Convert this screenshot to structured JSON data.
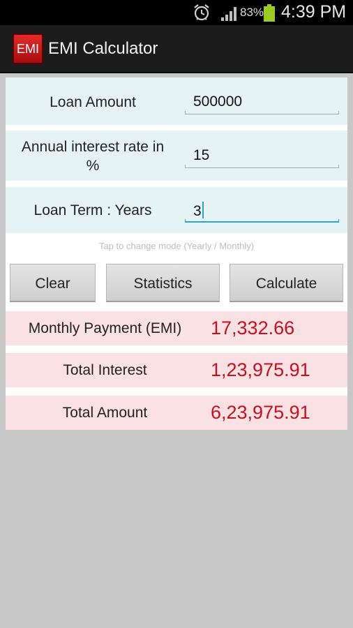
{
  "status_bar": {
    "battery_percent": "83%",
    "time": "4:39 PM",
    "icons": [
      "alarm-icon",
      "signal-icon",
      "battery-icon"
    ]
  },
  "app_bar": {
    "icon_text": "EMI",
    "title": "EMI Calculator"
  },
  "form": {
    "loan_amount": {
      "label": "Loan Amount",
      "value": "500000"
    },
    "interest_rate": {
      "label_line1": "Annual interest rate in",
      "label_line2": "%",
      "value": "15"
    },
    "loan_term": {
      "label": "Loan Term : Years",
      "value": "3"
    },
    "mode_hint": "Tap to change mode (Yearly / Monthly)"
  },
  "buttons": {
    "clear": "Clear",
    "statistics": "Statistics",
    "calculate": "Calculate"
  },
  "results": {
    "monthly_payment": {
      "label": "Monthly Payment (EMI)",
      "value": "17,332.66"
    },
    "total_interest": {
      "label": "Total Interest",
      "value": "1,23,975.91"
    },
    "total_amount": {
      "label": "Total Amount",
      "value": "6,23,975.91"
    }
  },
  "colors": {
    "input_row_bg": "#e6f3f5",
    "result_row_bg": "#f9e1e4",
    "result_value": "#c8101c",
    "focus_accent": "#2aa3d8",
    "battery": "#9ccc21"
  }
}
